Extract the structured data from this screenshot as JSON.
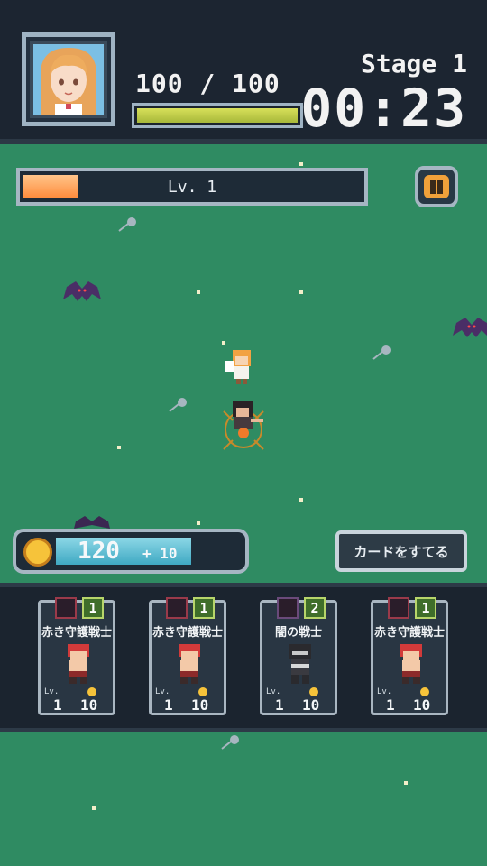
{
  "hud": {
    "hp_text": "100 / 100",
    "hp_fraction": 1.0,
    "stage_label": "Stage 1",
    "timer": "00:23"
  },
  "level": {
    "label": "Lv. 1",
    "xp_fraction": 0.16
  },
  "coins": {
    "amount": "120",
    "bonus": "+ 10"
  },
  "discard_button": {
    "label": "カードをすてる"
  },
  "cards": [
    {
      "type_icon": "shield-icon",
      "cost": "1",
      "name": "赤き守護戦士",
      "lv_label": "Lv.",
      "lv": "1",
      "price": "10",
      "portrait": "red-hair-warrior"
    },
    {
      "type_icon": "shield-icon",
      "cost": "1",
      "name": "赤き守護戦士",
      "lv_label": "Lv.",
      "lv": "1",
      "price": "10",
      "portrait": "red-hair-warrior"
    },
    {
      "type_icon": "sword-icon",
      "cost": "2",
      "name": "闇の戦士",
      "lv_label": "Lv.",
      "lv": "1",
      "price": "10",
      "portrait": "dark-warrior"
    },
    {
      "type_icon": "shield-icon",
      "cost": "1",
      "name": "赤き守護戦士",
      "lv_label": "Lv.",
      "lv": "1",
      "price": "10",
      "portrait": "red-hair-warrior"
    }
  ],
  "colors": {
    "field": "#2f8b62",
    "hud_bg": "#1c2531",
    "hp_fill": "#c8d548",
    "xp_fill": "#ff9a4a",
    "coin_fill": "#4fb5cc"
  }
}
